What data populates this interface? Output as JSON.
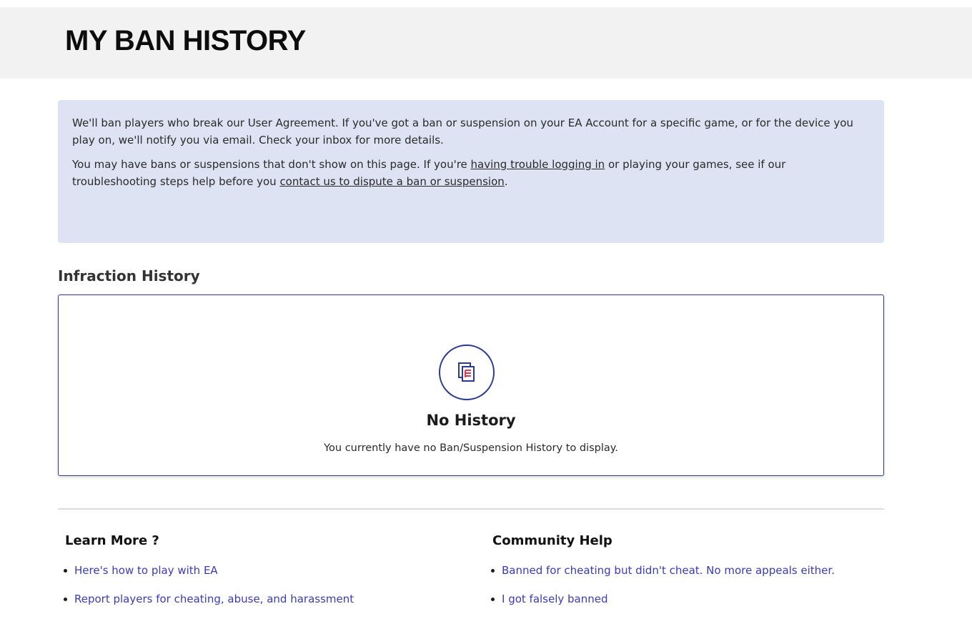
{
  "header": {
    "title": "MY BAN HISTORY"
  },
  "info": {
    "p1": "We'll ban players who break our User Agreement. If you've got a ban or suspension on your EA Account for a specific game, or for the device you play on, we'll notify you via email. Check your inbox for more details.",
    "p2_before": "You may have bans or suspensions that don't show on this page. If you're ",
    "p2_link1": "having trouble logging in",
    "p2_middle": " or playing your games, see if our troubleshooting steps help before you ",
    "p2_link2": "contact us to dispute a ban or suspension",
    "p2_after": "."
  },
  "infraction": {
    "heading": "Infraction History",
    "empty_title": "No History",
    "empty_desc": "You currently have no Ban/Suspension History to display.",
    "icon": "documents-icon"
  },
  "learn_more": {
    "heading": "Learn More ?",
    "links": [
      "Here's how to play with EA",
      "Report players for cheating, abuse, and harassment"
    ]
  },
  "community_help": {
    "heading": "Community Help",
    "links": [
      "Banned for cheating but didn't cheat. No more appeals either.",
      "I got falsely banned"
    ]
  },
  "colors": {
    "accent": "#2b3a8f",
    "info_bg": "#dde3f3",
    "link": "#3b3bb5",
    "icon_lines": "#e0374a"
  }
}
